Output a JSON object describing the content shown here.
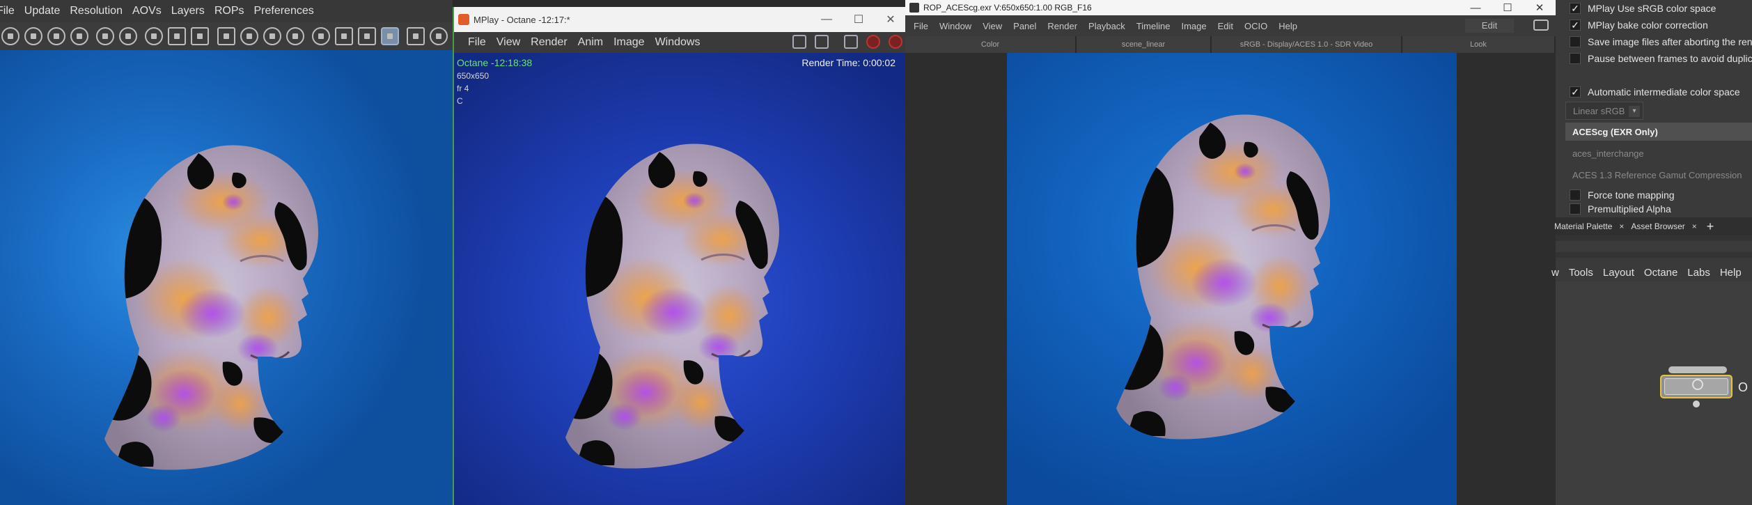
{
  "houdini_viewer": {
    "menu": [
      "File",
      "Update",
      "Resolution",
      "AOVs",
      "Layers",
      "ROPs",
      "Preferences"
    ],
    "toolbar_icons": [
      "play-icon",
      "skip-back-icon",
      "skip-forward-icon",
      "pause-icon",
      "refresh-icon",
      "power-icon",
      "contrast-icon",
      "fit-icon",
      "region-icon",
      "focus-icon",
      "sun-icon",
      "dots-icon",
      "target-icon",
      "clock-icon",
      "grid-icon",
      "home-icon",
      "zoom-icon",
      "crop-icon",
      "eye-icon"
    ]
  },
  "mplay_octane": {
    "title": "MPlay - Octane -12:17:*",
    "window_controls": [
      "—",
      "☐",
      "✕"
    ],
    "menu": [
      "File",
      "View",
      "Render",
      "Anim",
      "Image",
      "Windows"
    ],
    "overlay_title": "Octane -12:18:38",
    "overlay_lines": [
      "650x650",
      "fr 4",
      "C"
    ],
    "render_time": "Render Time: 0:00:02"
  },
  "rop_viewer": {
    "title": "ROP_ACEScg.exr V:650x650:1.00 RGB_F16",
    "window_controls": [
      "—",
      "☐",
      "✕"
    ],
    "menu": [
      "File",
      "Window",
      "View",
      "Panel",
      "Render",
      "Playback",
      "Timeline",
      "Image",
      "Edit",
      "OCIO",
      "Help"
    ],
    "edit_label": "Edit",
    "ocio_fields": [
      "Color",
      "scene_linear",
      "sRGB - Display/ACES 1.0 - SDR Video",
      "Look"
    ]
  },
  "settings": {
    "options": [
      {
        "label": "MPlay Use sRGB color space",
        "checked": true
      },
      {
        "label": "MPlay bake color correction",
        "checked": true
      },
      {
        "label": "Save image files after aborting the render",
        "checked": false
      },
      {
        "label": "Pause between frames to avoid duplicate",
        "checked": false
      }
    ],
    "auto_color": {
      "label": "Automatic intermediate color space",
      "checked": true
    },
    "linear_srgb": "Linear sRGB",
    "acescg": "ACEScg (EXR Only)",
    "aces_interchange": "aces_interchange",
    "aces_gamut": "ACES 1.3 Reference Gamut Compression",
    "force_tone": {
      "label": "Force tone mapping",
      "checked": false
    },
    "premult": {
      "label": "Premultiplied Alpha",
      "checked": false
    },
    "tabs": [
      {
        "label": "Material Palette"
      },
      {
        "label": "Asset Browser"
      }
    ],
    "tab_close": "×",
    "tab_add": "+",
    "menu": [
      "w",
      "Tools",
      "Layout",
      "Octane",
      "Labs",
      "Help"
    ],
    "node_label": "O"
  },
  "colors": {
    "accent_green": "#6fe36f",
    "node_selected": "#e7c43b"
  }
}
